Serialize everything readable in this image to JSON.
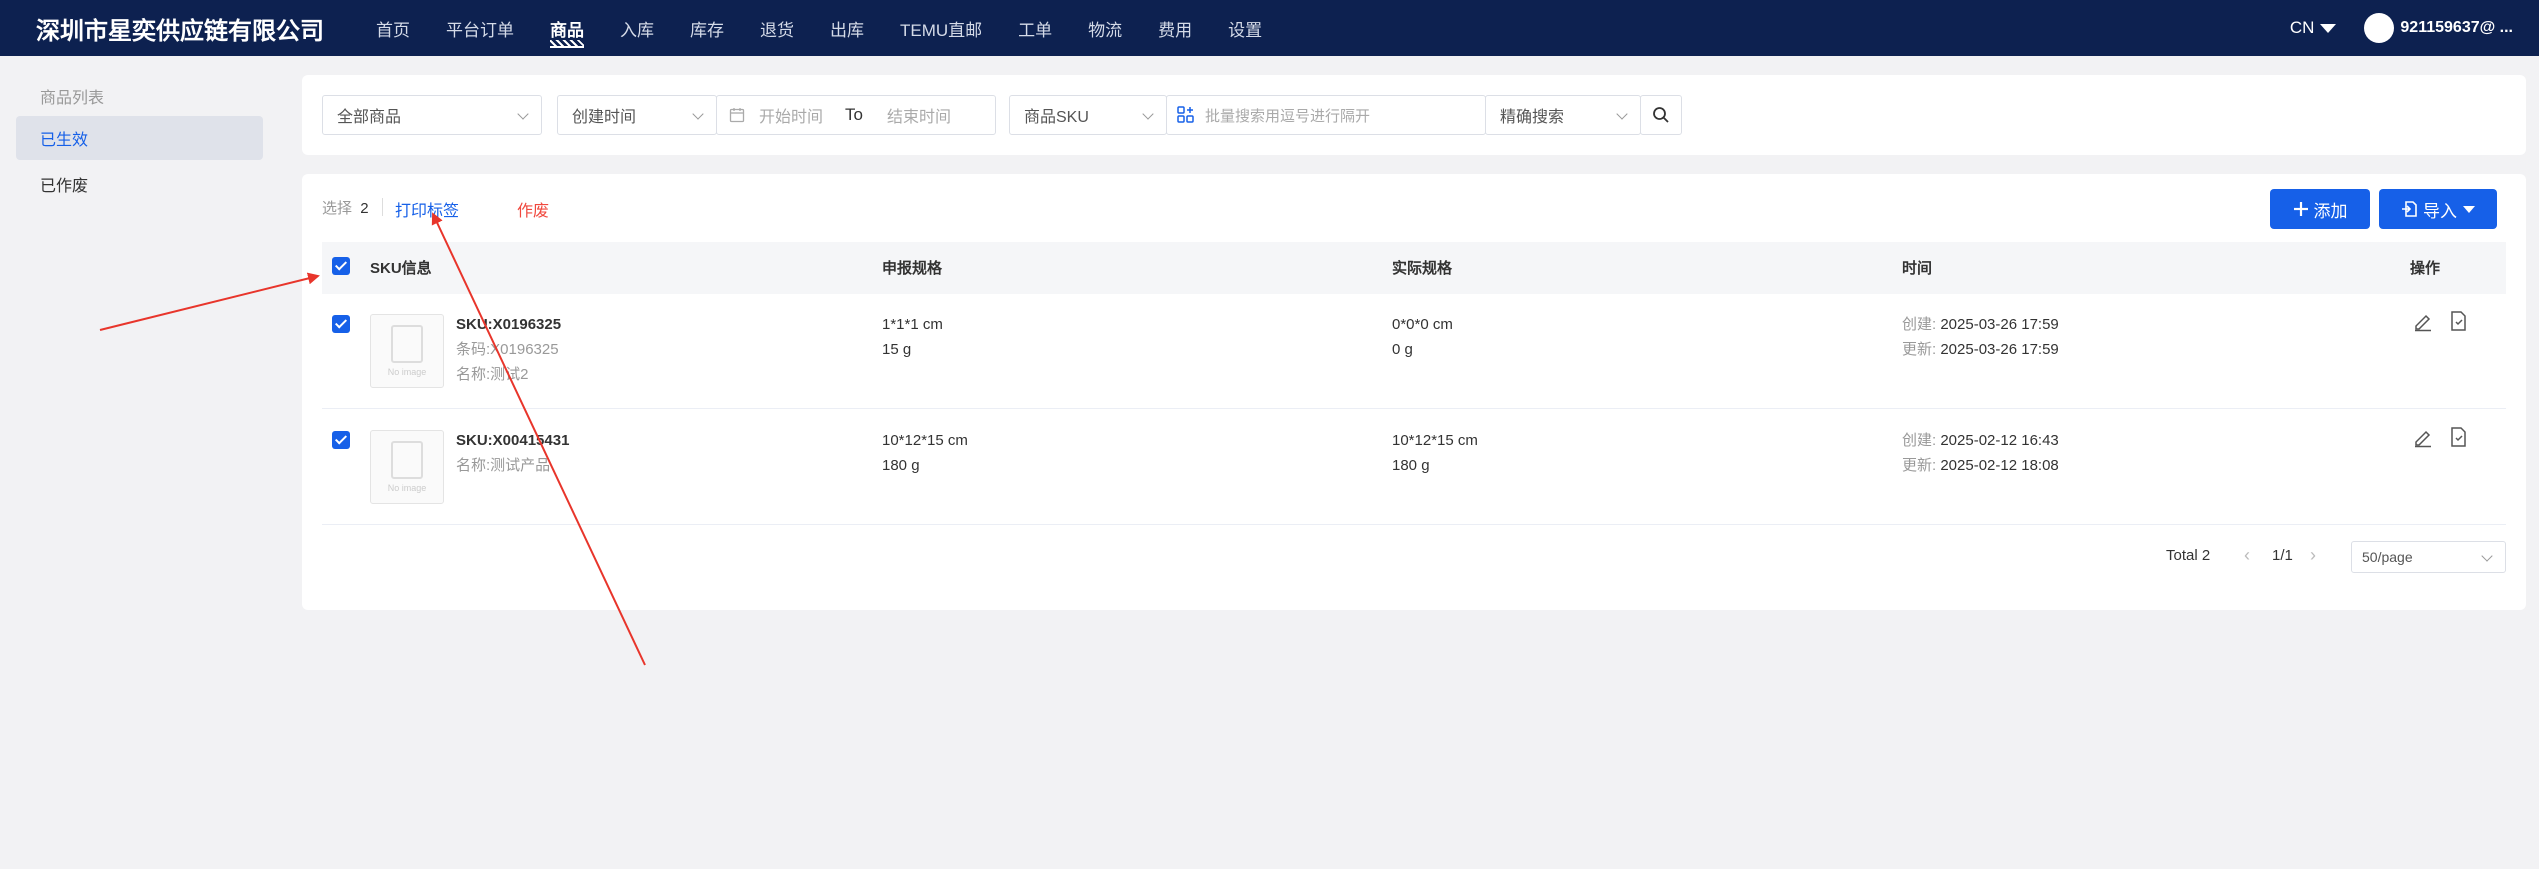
{
  "header": {
    "brand": "深圳市星奕供应链有限公司",
    "nav": [
      "首页",
      "平台订单",
      "商品",
      "入库",
      "库存",
      "退货",
      "出库",
      "TEMU直邮",
      "工单",
      "物流",
      "费用",
      "设置"
    ],
    "active_nav": "商品",
    "lang": "CN",
    "user": "921159637@ ..."
  },
  "sidebar": {
    "title": "商品列表",
    "items": [
      {
        "label": "已生效",
        "active": true
      },
      {
        "label": "已作废",
        "active": false
      }
    ]
  },
  "filters": {
    "goods_select": "全部商品",
    "time_select": "创建时间",
    "start_placeholder": "开始时间",
    "to_label": "To",
    "end_placeholder": "结束时间",
    "sku_select": "商品SKU",
    "batch_placeholder": "批量搜索用逗号进行隔开",
    "match_select": "精确搜索"
  },
  "toolbar": {
    "selected_label": "选择",
    "selected_count": "2",
    "print_label": "打印标签",
    "void_label": "作废",
    "add_label": "添加",
    "import_label": "导入"
  },
  "table": {
    "columns": [
      "SKU信息",
      "申报规格",
      "实际规格",
      "时间",
      "操作"
    ],
    "rows": [
      {
        "sku": "SKU:X0196325",
        "barcode": "条码:X0196325",
        "name": "名称:测试2",
        "declared_size": "1*1*1 cm",
        "declared_weight": "15 g",
        "actual_size": "0*0*0 cm",
        "actual_weight": "0 g",
        "created_label": "创建:",
        "created": "2025-03-26 17:59",
        "updated_label": "更新:",
        "updated": "2025-03-26 17:59"
      },
      {
        "sku": "SKU:X00415431",
        "barcode": "",
        "name": "名称:测试产品",
        "declared_size": "10*12*15 cm",
        "declared_weight": "180 g",
        "actual_size": "10*12*15 cm",
        "actual_weight": "180 g",
        "created_label": "创建:",
        "created": "2025-02-12 16:43",
        "updated_label": "更新:",
        "updated": "2025-02-12 18:08"
      }
    ],
    "no_image": "No image"
  },
  "pagination": {
    "total": "Total 2",
    "page": "1/1",
    "page_size": "50/page"
  },
  "colors": {
    "nav_bg": "#0d2150",
    "primary": "#1660e8",
    "danger": "#f0483e",
    "annotation_arrow": "#e8352b"
  }
}
